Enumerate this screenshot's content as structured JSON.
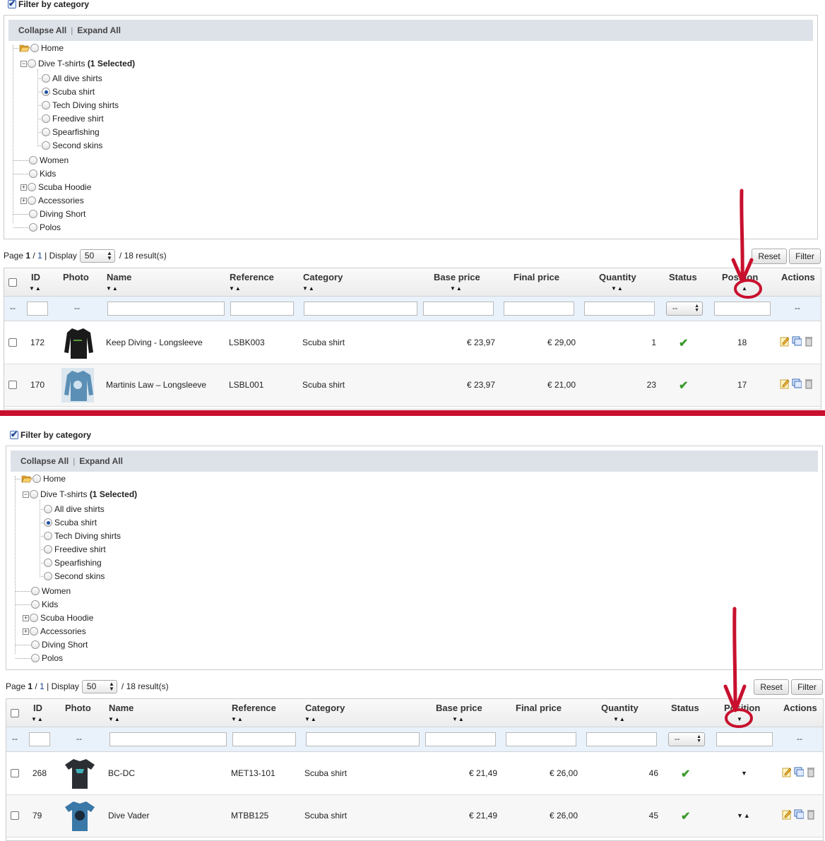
{
  "filter": {
    "label": "Filter by category"
  },
  "collapse": {
    "collapse_label": "Collapse All",
    "separator": "|",
    "expand_label": "Expand All"
  },
  "tree": {
    "home": "Home",
    "dive": "Dive T-shirts",
    "dive_selected": "(1 Selected)",
    "children": [
      "All dive shirts",
      "Scuba shirt",
      "Tech Diving shirts",
      "Freedive shirt",
      "Spearfishing",
      "Second skins"
    ],
    "top": [
      "Women",
      "Kids",
      "Scuba Hoodie",
      "Accessories",
      "Diving Short",
      "Polos"
    ],
    "selected_child": "Scuba shirt"
  },
  "pager": {
    "page_label": "Page",
    "page": "1",
    "slash": "/",
    "total_pages": "1",
    "display_label": "| Display",
    "per_page": "50",
    "results": "/ 18 result(s)"
  },
  "buttons": {
    "reset": "Reset",
    "filter": "Filter"
  },
  "columns": {
    "id": "ID",
    "photo": "Photo",
    "name": "Name",
    "reference": "Reference",
    "category": "Category",
    "base_price": "Base price",
    "final_price": "Final price",
    "quantity": "Quantity",
    "status": "Status",
    "position": "Position",
    "actions": "Actions"
  },
  "filter_row": {
    "dash": "--",
    "status_select": "--"
  },
  "top_rows": [
    {
      "id": "172",
      "name": "Keep Diving - Longsleeve",
      "reference": "LSBK003",
      "category": "Scuba shirt",
      "base_price": "€ 23,97",
      "final_price": "€ 29,00",
      "quantity": "1",
      "position": "18",
      "status": "enabled",
      "photo": "black longsleeve"
    },
    {
      "id": "170",
      "name": "Martinis Law – Longsleeve",
      "reference": "LSBL001",
      "category": "Scuba shirt",
      "base_price": "€ 23,97",
      "final_price": "€ 21,00",
      "quantity": "23",
      "position": "17",
      "status": "enabled",
      "photo": "blue longsleeve"
    }
  ],
  "bottom_rows": [
    {
      "id": "268",
      "name": "BC-DC",
      "reference": "MET13-101",
      "category": "Scuba shirt",
      "base_price": "€ 21,49",
      "final_price": "€ 26,00",
      "quantity": "46",
      "status": "enabled",
      "photo": "dark t-shirt"
    },
    {
      "id": "79",
      "name": "Dive Vader",
      "reference": "MTBB125",
      "category": "Scuba shirt",
      "base_price": "€ 21,49",
      "final_price": "€ 26,00",
      "quantity": "45",
      "status": "enabled",
      "photo": "blue t-shirt"
    }
  ],
  "colors": {
    "annotation": "#c8102e",
    "divider": "#c8102e",
    "header_bar": "#dde1e8",
    "filter_row": "#e9f2fb",
    "status_ok": "#3a9a2a"
  }
}
